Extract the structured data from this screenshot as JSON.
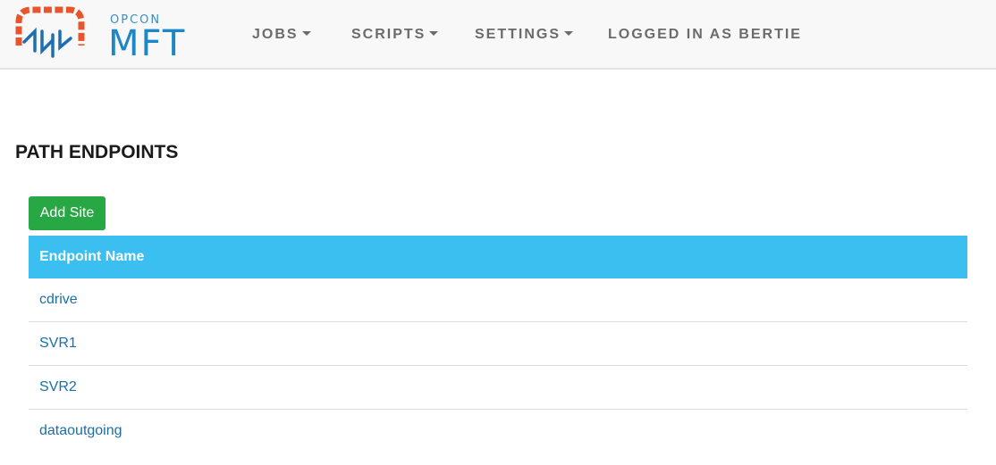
{
  "brand": {
    "small": "OPCON",
    "big": "MFT",
    "colors": {
      "primary": "#1f86c6",
      "accent": "#e8542b"
    },
    "icon": "opcon-mft-logo-icon"
  },
  "nav": {
    "jobs": "JOBS",
    "scripts": "SCRIPTS",
    "settings": "SETTINGS",
    "user": "LOGGED IN AS BERTIE"
  },
  "page": {
    "title": "PATH ENDPOINTS",
    "add_button": "Add Site"
  },
  "table": {
    "header": "Endpoint Name",
    "header_color": "#3bbff0",
    "rows": [
      "cdrive",
      "SVR1",
      "SVR2",
      "dataoutgoing"
    ]
  }
}
